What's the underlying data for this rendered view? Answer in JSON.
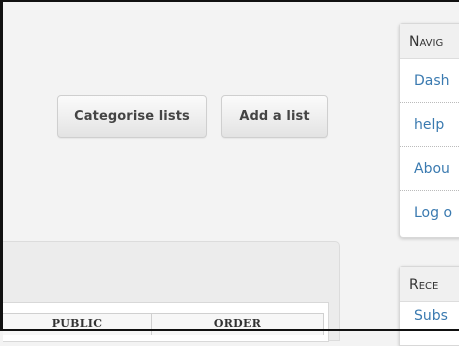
{
  "toolbar": {
    "categorise_label": "Categorise lists",
    "add_label": "Add a list"
  },
  "table": {
    "headers": [
      "PUBLIC",
      "ORDER"
    ]
  },
  "navigation": {
    "title": "Navig",
    "items": [
      {
        "label": "Dash"
      },
      {
        "label": "help"
      },
      {
        "label": "Abou"
      },
      {
        "label": "Log o"
      }
    ]
  },
  "recent": {
    "title": "Rece",
    "items": [
      {
        "label": "Subs"
      }
    ]
  },
  "colors": {
    "link": "#3a7ab0",
    "background": "#f3f3f3",
    "panel_header": "#f0f0f0"
  }
}
